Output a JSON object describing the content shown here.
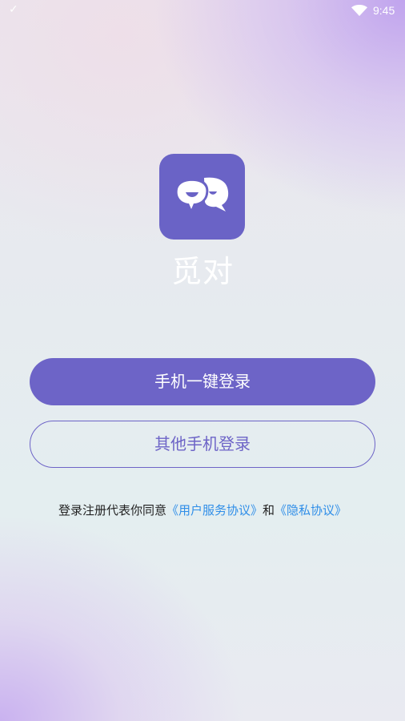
{
  "status_bar": {
    "left_icon": "check-icon",
    "wifi_icon": "wifi-icon",
    "time": "9:45"
  },
  "app": {
    "icon": "chat-bubbles-icon",
    "name": "觅对",
    "icon_color": "#6a63c6"
  },
  "buttons": {
    "one_click_login": "手机一键登录",
    "other_phone_login": "其他手机登录",
    "accent": "#6d64c7"
  },
  "agreement": {
    "prefix": "登录注册代表你同意",
    "user_agreement": "《用户服务协议》",
    "conjunction": "和",
    "privacy_agreement": "《隐私协议》",
    "link_color": "#2f8ee8"
  }
}
